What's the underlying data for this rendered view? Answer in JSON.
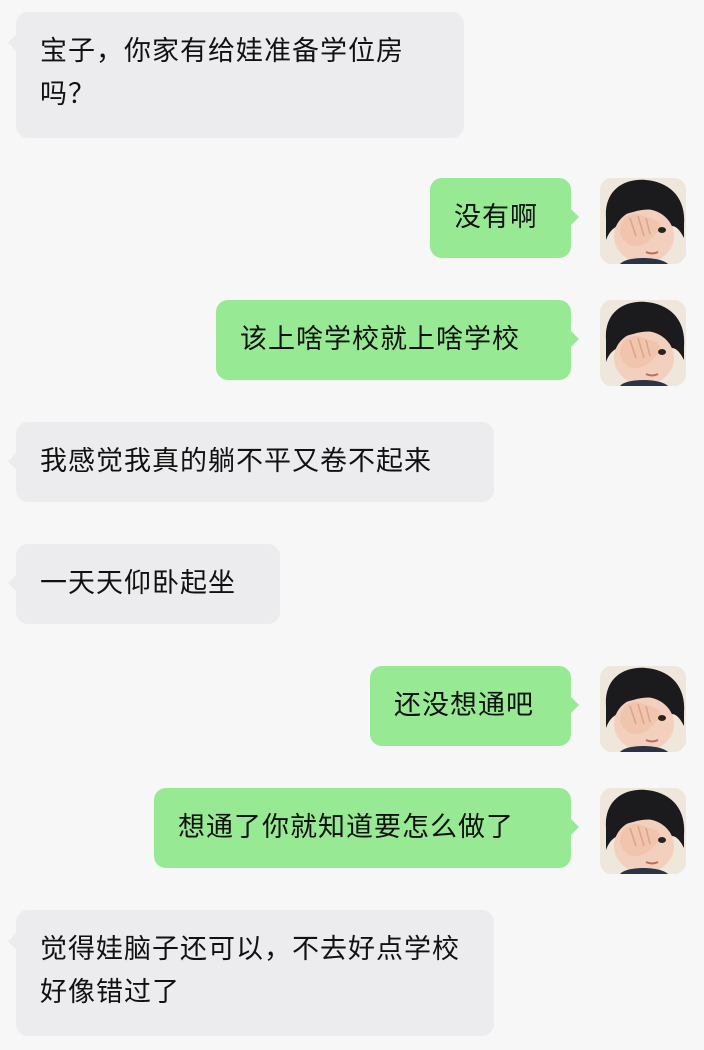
{
  "colors": {
    "background": "#f7f7f7",
    "incoming_bubble": "#ececee",
    "outgoing_bubble": "#98e993",
    "text": "#111111"
  },
  "avatar": {
    "icon": "child-covering-face-avatar-icon"
  },
  "messages": [
    {
      "direction": "incoming",
      "text": "宝子，你家有给娃准备学位房吗？"
    },
    {
      "direction": "outgoing",
      "text": "没有啊"
    },
    {
      "direction": "outgoing",
      "text": "该上啥学校就上啥学校"
    },
    {
      "direction": "incoming",
      "text": "我感觉我真的躺不平又卷不起来"
    },
    {
      "direction": "incoming",
      "text": "一天天仰卧起坐"
    },
    {
      "direction": "outgoing",
      "text": "还没想通吧"
    },
    {
      "direction": "outgoing",
      "text": "想通了你就知道要怎么做了"
    },
    {
      "direction": "incoming",
      "text": "觉得娃脑子还可以，不去好点学校好像错过了"
    }
  ]
}
